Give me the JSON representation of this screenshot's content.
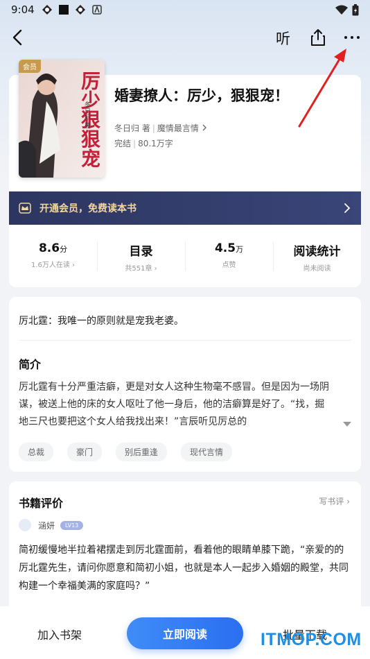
{
  "status_bar": {
    "time": "9:04"
  },
  "nav": {
    "listen_label": "听"
  },
  "book": {
    "cover_badge": "会员",
    "cover_title": "厉少狠狠宠",
    "cover_author": "冬日归 著",
    "title": "婚妻撩人：厉少，狠狠宠！",
    "author": "冬日归 著",
    "category": "魔情最言情",
    "status": "完结",
    "word_count": "80.1万字"
  },
  "vip_banner": {
    "label": "开通会员，免费读本书"
  },
  "stats": [
    {
      "value": "8.6",
      "unit": "分",
      "sub": "1.6万人在读"
    },
    {
      "value": "目录",
      "unit": "",
      "sub": "共551章"
    },
    {
      "value": "4.5",
      "unit": "万",
      "sub": "点赞"
    },
    {
      "value": "阅读统计",
      "unit": "",
      "sub": "尚未阅读"
    }
  ],
  "intro": {
    "quote": "厉北霆：我唯一的原则就是宠我老婆。",
    "title": "简介",
    "text": "厉北霆有十分严重洁癖，更是对女人这种生物毫不感冒。但是因为一场阴谋，被送上他的床的女人呕吐了他一身后，他的洁癖算是好了。“找，掘地三尺也要把这个女人给我找出来！”言辰听见厉总的",
    "tags": [
      "总裁",
      "豪门",
      "别后重逢",
      "现代言情"
    ]
  },
  "review": {
    "title": "书籍评价",
    "write_label": "写书评",
    "reviewer_name": "涵妍",
    "reviewer_level": "LV13",
    "text": "简初缓慢地半拉着裙摆走到厉北霆面前，看着他的眼睛单膝下跪，“亲爱的的厉北霆先生，请问你愿意和简初小姐，也就是本人一起步入婚姻的殿堂，共同构建一个幸福美满的家庭吗？”"
  },
  "bottom_bar": {
    "shelf_label": "加入书架",
    "read_label": "立即阅读",
    "download_label": "批量下载"
  },
  "watermark": "ITMOP.COM",
  "colors": {
    "accent": "#2a6ff0",
    "vip_text": "#f4d7a0",
    "vip_bg": "#2d3660"
  }
}
